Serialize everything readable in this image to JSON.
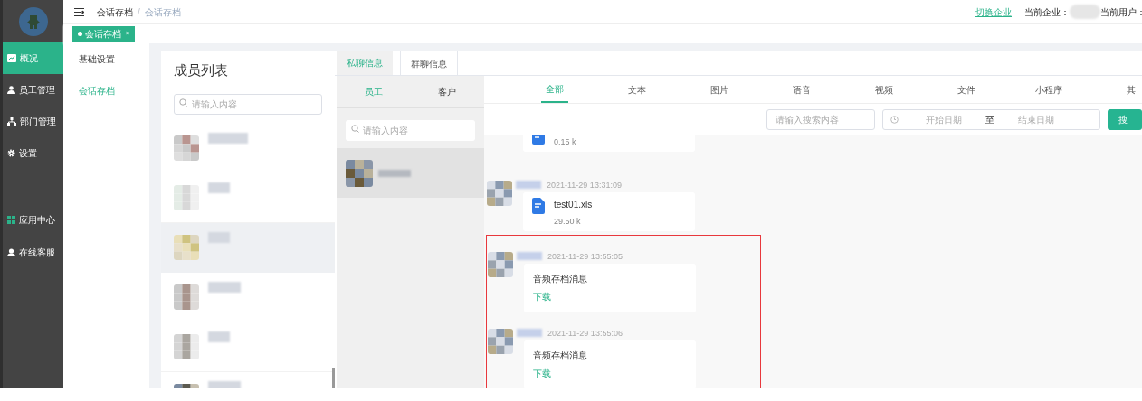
{
  "sidebar": {
    "items": [
      {
        "label": "概况",
        "selected": true
      },
      {
        "label": "员工管理",
        "selected": false
      },
      {
        "label": "部门管理",
        "selected": false
      },
      {
        "label": "设置",
        "selected": false
      }
    ],
    "extras": [
      {
        "label": "应用中心"
      },
      {
        "label": "在线客服"
      }
    ]
  },
  "topbar": {
    "breadcrumb": [
      "会话存档",
      "会话存档"
    ],
    "breadcrumb_separator": "/",
    "switch_link": "切换企业",
    "company_label": "当前企业：",
    "user_label": "当前用户："
  },
  "tags": [
    {
      "label": "会话存档",
      "close": "×",
      "selected": true
    }
  ],
  "subnav": {
    "items": [
      {
        "label": "基础设置",
        "selected": false
      },
      {
        "label": "会话存档",
        "selected": true
      }
    ]
  },
  "members": {
    "title": "成员列表",
    "search_placeholder": "请输入内容",
    "rows": [
      {
        "selected": false
      },
      {
        "selected": false
      },
      {
        "selected": true
      },
      {
        "selected": false
      },
      {
        "selected": false
      },
      {
        "selected": false
      }
    ]
  },
  "chat": {
    "tabs": [
      {
        "label": "私聊信息",
        "selected": true
      },
      {
        "label": "群聊信息",
        "selected": false
      }
    ],
    "party_tabs": [
      {
        "label": "员工",
        "selected": true
      },
      {
        "label": "客户",
        "selected": false
      }
    ],
    "contact_search_placeholder": "请输入内容",
    "contacts": [
      {
        "selected": true
      }
    ],
    "categories": [
      {
        "label": "全部",
        "selected": true
      },
      {
        "label": "文本",
        "selected": false
      },
      {
        "label": "图片",
        "selected": false
      },
      {
        "label": "语音",
        "selected": false
      },
      {
        "label": "视频",
        "selected": false
      },
      {
        "label": "文件",
        "selected": false
      },
      {
        "label": "小程序",
        "selected": false
      },
      {
        "label": "其",
        "selected": false
      }
    ],
    "search": {
      "placeholder": "请输入搜索内容",
      "start_placeholder": "开始日期",
      "separator": "至",
      "end_placeholder": "结束日期",
      "button": "搜"
    },
    "messages": [
      {
        "kind": "file",
        "size": "0.15 k",
        "highlighted": false
      },
      {
        "kind": "file",
        "time": "2021-11-29 13:31:09",
        "file_name": "test01.xls",
        "size": "29.50 k",
        "highlighted": false
      },
      {
        "kind": "audio",
        "time": "2021-11-29 13:55:05",
        "text": "音频存档消息",
        "link": "下载",
        "highlighted": true
      },
      {
        "kind": "audio",
        "time": "2021-11-29 13:55:06",
        "text": "音频存档消息",
        "link": "下载",
        "highlighted": true
      }
    ]
  }
}
